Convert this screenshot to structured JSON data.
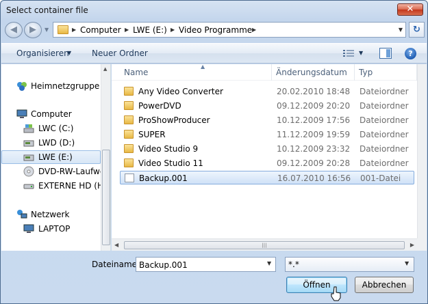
{
  "window": {
    "title": "Select container file",
    "close_label": "✕"
  },
  "address": {
    "breadcrumbs": [
      "Computer",
      "LWE (E:)",
      "Video Programme"
    ]
  },
  "toolbar": {
    "organize_label": "Organisieren",
    "new_folder_label": "Neuer Ordner",
    "help_label": "?"
  },
  "navigation": {
    "items": [
      {
        "label": "Heimnetzgruppe",
        "icon": "homegroup-icon",
        "indent": 0
      },
      {
        "label": "Computer",
        "icon": "computer-icon",
        "indent": 0
      },
      {
        "label": "LWC (C:)",
        "icon": "system-drive-icon",
        "indent": 1
      },
      {
        "label": "LWD (D:)",
        "icon": "drive-icon",
        "indent": 1
      },
      {
        "label": "LWE (E:)",
        "icon": "drive-icon",
        "indent": 1,
        "selected": true
      },
      {
        "label": "DVD-RW-Laufwerk",
        "icon": "dvd-drive-icon",
        "indent": 1
      },
      {
        "label": "EXTERNE HD (H:)",
        "icon": "external-drive-icon",
        "indent": 1
      },
      {
        "label": "Netzwerk",
        "icon": "network-icon",
        "indent": 0
      },
      {
        "label": "LAPTOP",
        "icon": "computer-icon",
        "indent": 1
      }
    ]
  },
  "file_list": {
    "columns": [
      "Name",
      "Änderungsdatum",
      "Typ"
    ],
    "rows": [
      {
        "name": "Any Video Converter",
        "date": "20.02.2010 18:48",
        "type": "Dateiordner",
        "icon": "folder-icon"
      },
      {
        "name": "PowerDVD",
        "date": "09.12.2009 20:20",
        "type": "Dateiordner",
        "icon": "folder-icon"
      },
      {
        "name": "ProShowProducer",
        "date": "10.12.2009 17:56",
        "type": "Dateiordner",
        "icon": "folder-icon"
      },
      {
        "name": "SUPER",
        "date": "11.12.2009 19:59",
        "type": "Dateiordner",
        "icon": "folder-icon"
      },
      {
        "name": "Video Studio 9",
        "date": "10.12.2009 23:32",
        "type": "Dateiordner",
        "icon": "folder-icon"
      },
      {
        "name": "Video Studio 11",
        "date": "09.12.2009 20:28",
        "type": "Dateiordner",
        "icon": "folder-icon"
      },
      {
        "name": "Backup.001",
        "date": "16.07.2010 16:56",
        "type": "001-Datei",
        "icon": "file-icon",
        "selected": true
      }
    ]
  },
  "bottom": {
    "filename_label": "Dateiname:",
    "filename_value": "Backup.001",
    "filter_value": "*.*",
    "open_label": "Öffnen",
    "cancel_label": "Abbrechen"
  },
  "colors": {
    "selection_border": "#84acdd",
    "title_close": "#c2361b",
    "folder": "#e8b844"
  }
}
